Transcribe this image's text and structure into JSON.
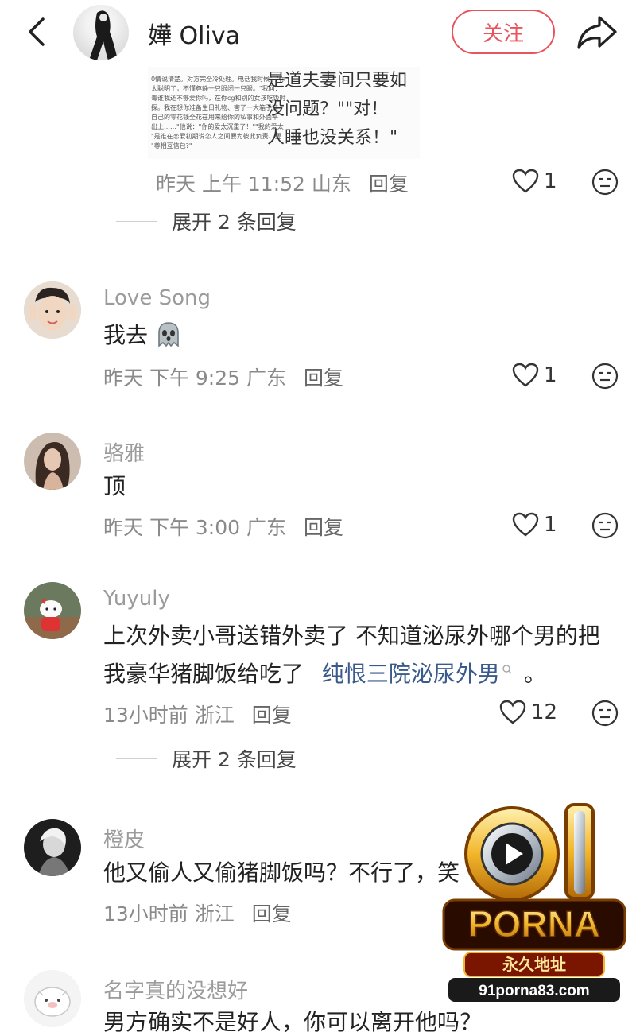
{
  "header": {
    "back_icon": "chevron-left-icon",
    "user_name": "嬅 Oliva",
    "follow_label": "关注",
    "share_icon": "share-arrow-icon",
    "accent_color": "#e8545e"
  },
  "first_comment": {
    "image_text_left": [
      "0情说清楚。对方完全冷处理。电话我时候：\"你",
      "太聪明了，不懂尊静一只眼闭一只眼。\"我问：",
      "毒谁我还不够爱你吗，在你cg和别的女孩吃饭时",
      "探。我在想你准备生日礼物、害了一大箱子过",
      "自己的零花钱全花在用来给你的私事和外面平",
      "出上……\"他说：\"你的爱太沉重了！\"\"我的爱太",
      "\"是谁在恋爱初期说恋人之间要为彼此负责、要",
      "\"尊相互信包?\""
    ],
    "image_text_right": [
      "是道夫妻间只要如",
      "没问题？\"\"对！",
      "人睡也没关系！\""
    ],
    "time": "昨天 上午 11:52 山东",
    "reply_label": "回复",
    "likes": "1",
    "expand_label": "展开 2 条回复"
  },
  "comments": [
    {
      "username": "Love Song",
      "text": "我去",
      "emoji": "ghost-face-emoji",
      "time": "昨天 下午 9:25 广东",
      "reply_label": "回复",
      "likes": "1"
    },
    {
      "username": "骆雅",
      "text": "顶",
      "time": "昨天 下午 3:00 广东",
      "reply_label": "回复",
      "likes": "1"
    },
    {
      "username": "Yuyuly",
      "text_line1": "上次外卖小哥送错外卖了 不知道泌尿外哪个男的把",
      "text_line2": "我豪华猪脚饭给吃了",
      "hashtag": "纯恨三院泌尿外男",
      "text_end": "。",
      "time": "13小时前 浙江",
      "reply_label": "回复",
      "likes": "12",
      "expand_label": "展开 2 条回复"
    },
    {
      "username": "橙皮",
      "text": "他又偷人又偷猪脚饭吗？不行了，笑",
      "time": "13小时前 浙江",
      "reply_label": "回复"
    },
    {
      "username": "名字真的没想好",
      "text": "男方确实不是好人，你可以离开他吗？"
    }
  ],
  "watermark": {
    "brand_number": "91",
    "brand_name": "PORNA",
    "tagline": "永久地址",
    "url": "91porna83.com"
  }
}
